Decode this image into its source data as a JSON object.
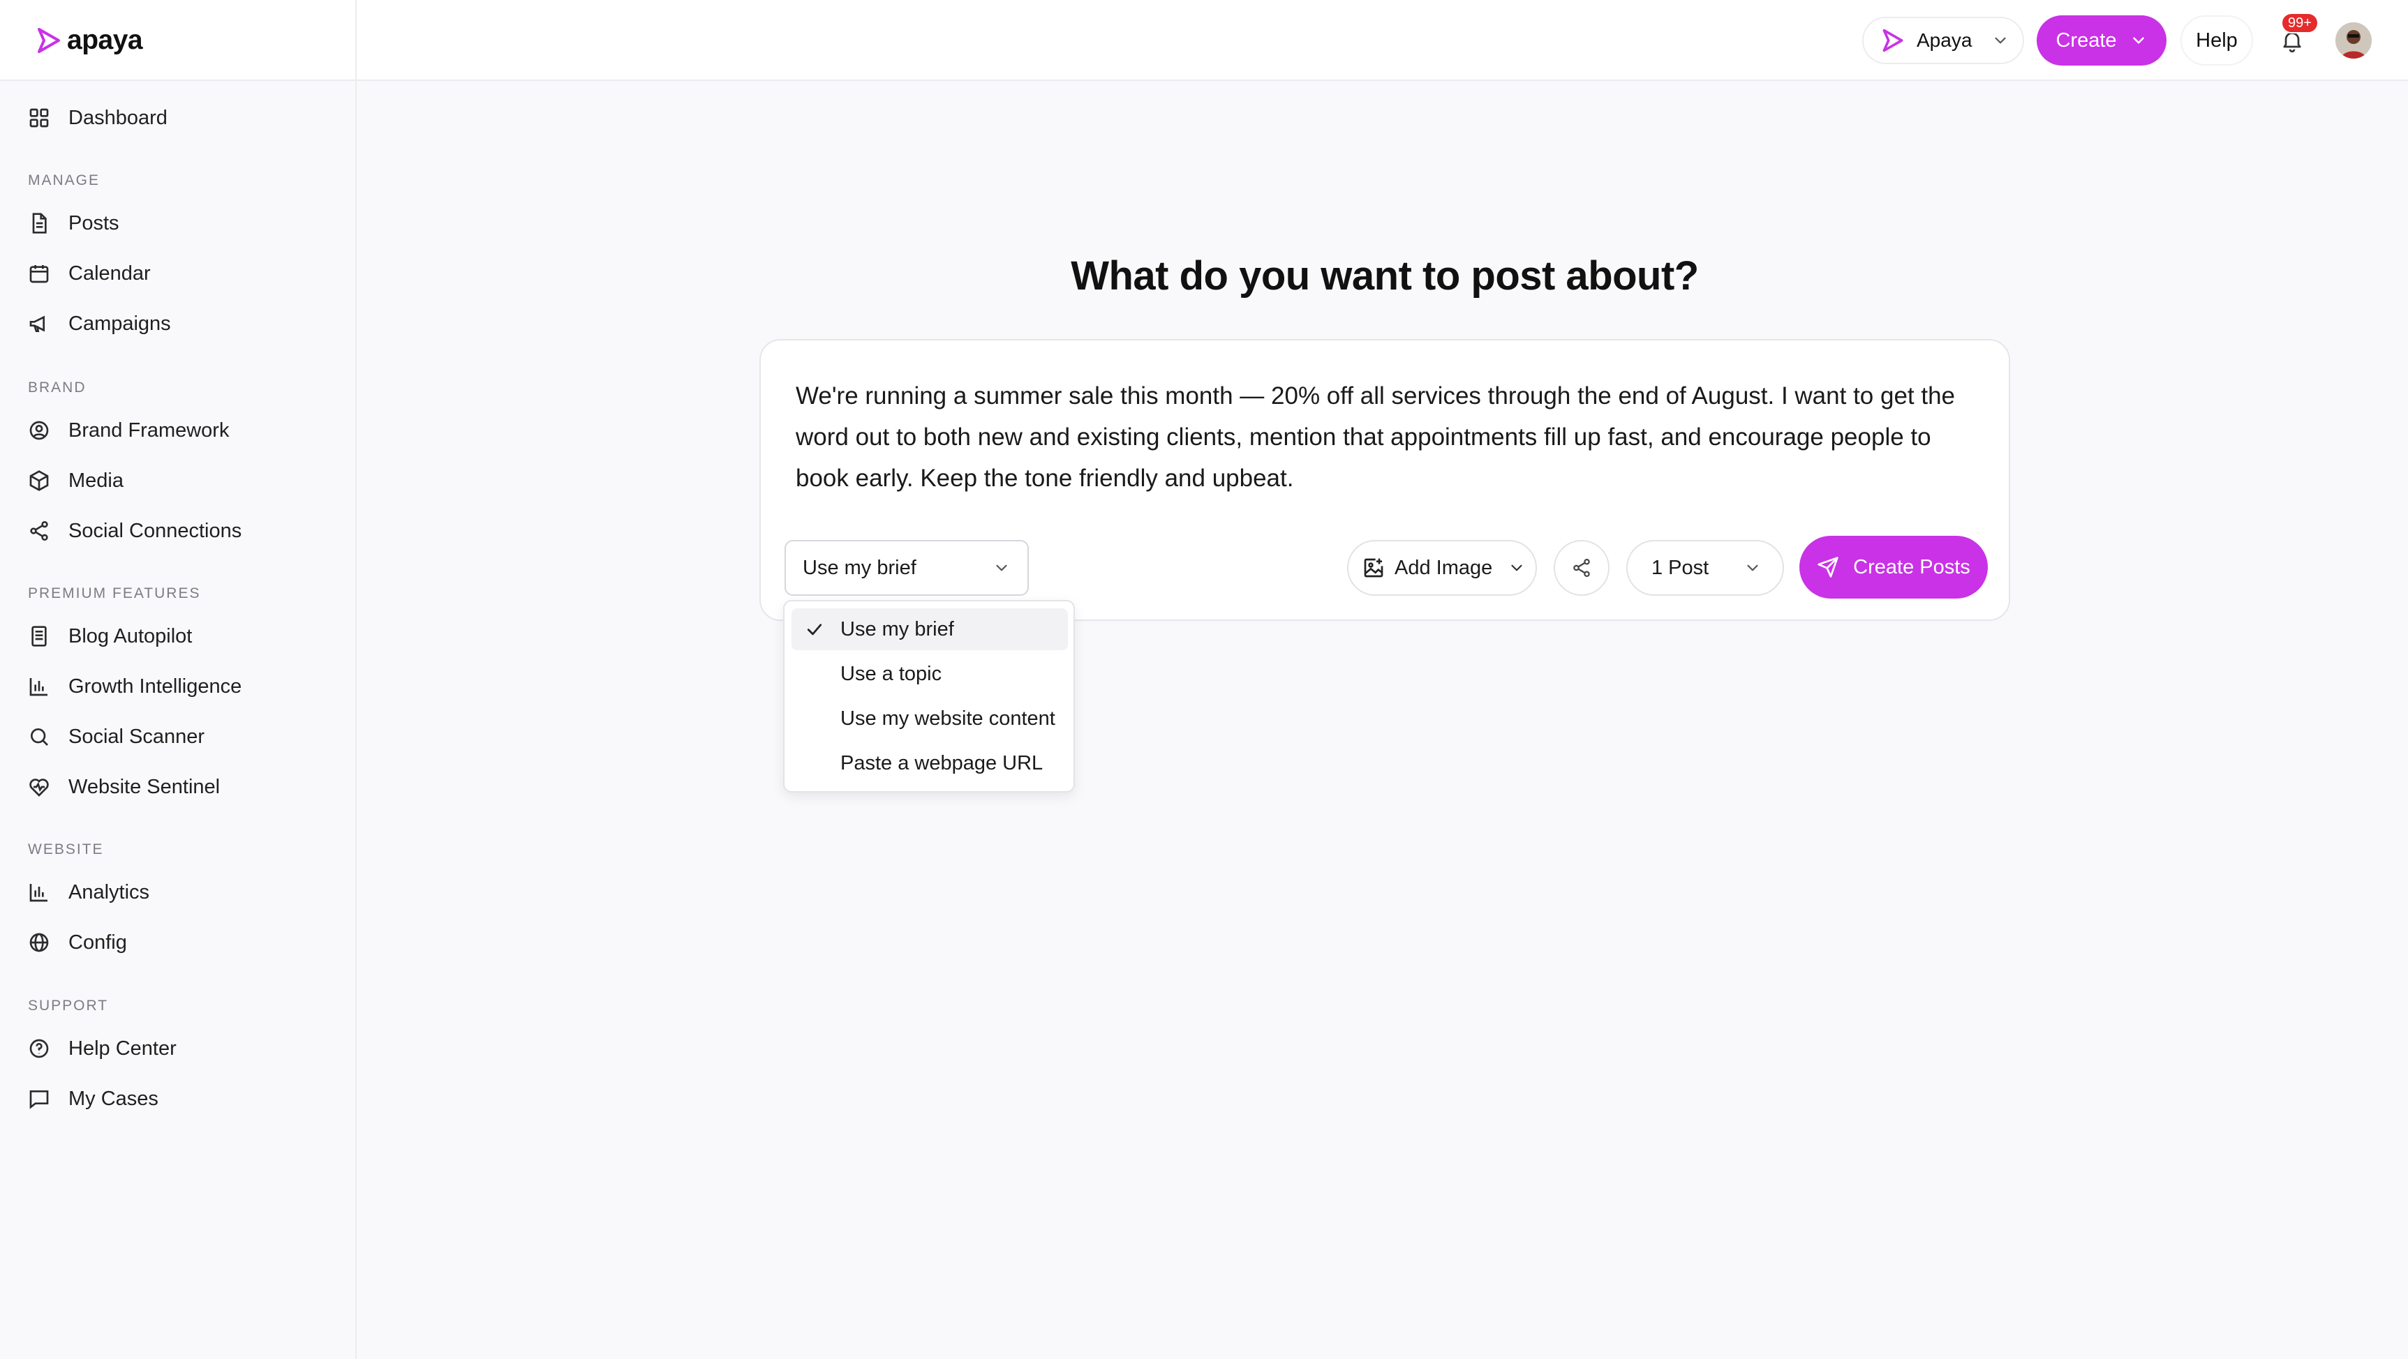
{
  "app": {
    "logo_text": "apaya",
    "brand_color": "#c932e6"
  },
  "header": {
    "workspace_label": "Apaya",
    "create_label": "Create",
    "help_label": "Help",
    "notification_badge": "99+"
  },
  "sidebar": {
    "dashboard": "Dashboard",
    "sections": {
      "manage": "MANAGE",
      "brand": "BRAND",
      "premium": "PREMIUM FEATURES",
      "website": "WEBSITE",
      "support": "SUPPORT"
    },
    "items": {
      "posts": "Posts",
      "calendar": "Calendar",
      "campaigns": "Campaigns",
      "brand_framework": "Brand Framework",
      "media": "Media",
      "social_connections": "Social Connections",
      "blog_autopilot": "Blog Autopilot",
      "growth_intelligence": "Growth Intelligence",
      "social_scanner": "Social Scanner",
      "website_sentinel": "Website Sentinel",
      "analytics": "Analytics",
      "config": "Config",
      "help_center": "Help Center",
      "my_cases": "My Cases"
    }
  },
  "main": {
    "headline": "What do you want to post about?",
    "brief_text": "We're running a summer sale this month — 20% off all services through the end of August. I want to get the word out to both new and existing clients, mention that appointments fill up fast, and encourage people to book early. Keep the tone friendly and upbeat.",
    "source_select_value": "Use my brief",
    "add_image_label": "Add Image",
    "post_count_value": "1 Post",
    "create_posts_label": "Create Posts"
  },
  "source_menu": {
    "options": [
      "Use my brief",
      "Use a topic",
      "Use my website content",
      "Paste a webpage URL"
    ],
    "selected": "Use my brief"
  }
}
